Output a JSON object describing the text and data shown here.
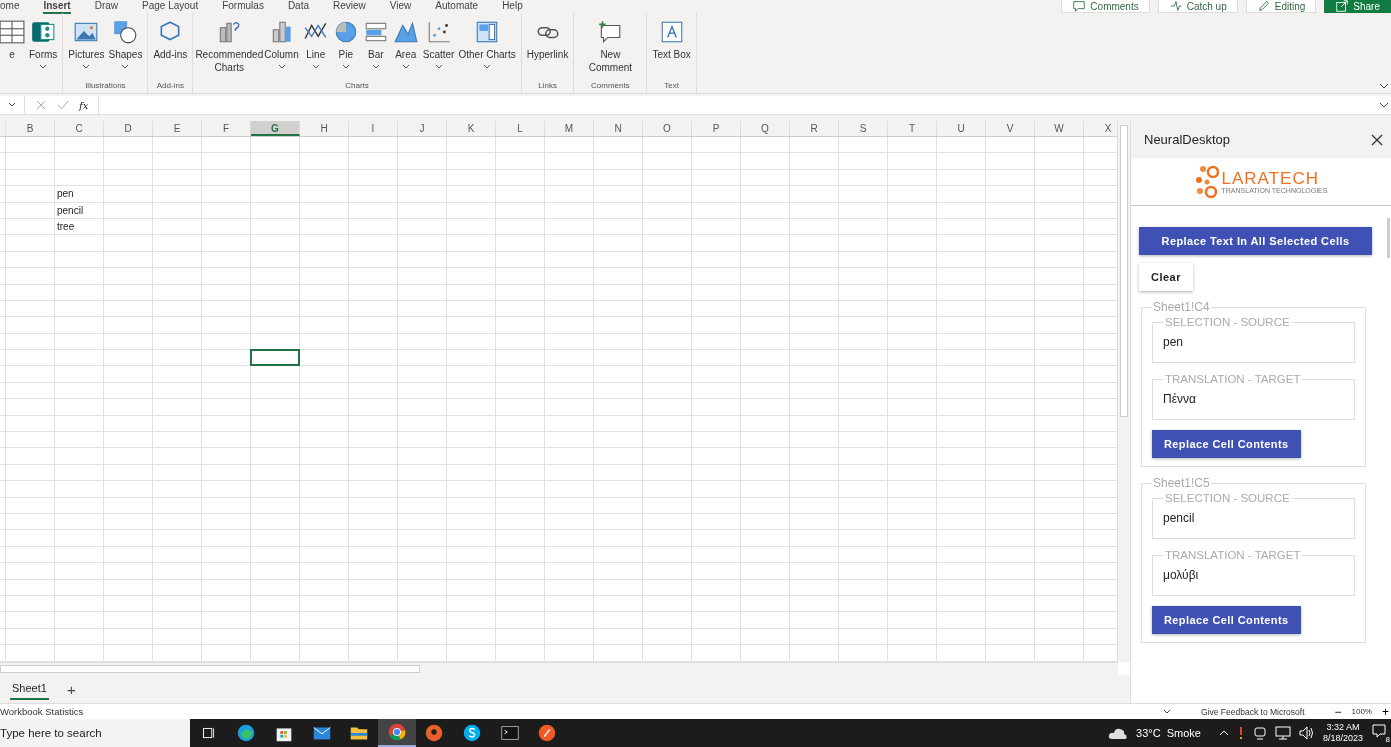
{
  "ribbon_tabs": [
    {
      "label": "ome",
      "selected": false
    },
    {
      "label": "Insert",
      "selected": true
    },
    {
      "label": "Draw",
      "selected": false
    },
    {
      "label": "Page Layout",
      "selected": false
    },
    {
      "label": "Formulas",
      "selected": false
    },
    {
      "label": "Data",
      "selected": false
    },
    {
      "label": "Review",
      "selected": false
    },
    {
      "label": "View",
      "selected": false
    },
    {
      "label": "Automate",
      "selected": false
    },
    {
      "label": "Help",
      "selected": false
    }
  ],
  "top_buttons": [
    {
      "label": "Comments",
      "kind": "comments"
    },
    {
      "label": "Catch up",
      "kind": "catchup"
    },
    {
      "label": "Editing",
      "kind": "editing"
    },
    {
      "label": "Share",
      "kind": "share"
    }
  ],
  "ribbon_groups": [
    {
      "buttons": [
        {
          "label": "e",
          "kind": "table",
          "dropdown": false
        },
        {
          "label": "Forms",
          "kind": "forms",
          "dropdown": true
        }
      ]
    },
    {
      "label": "Illustrations",
      "buttons": [
        {
          "label": "Pictures",
          "kind": "pictures",
          "dropdown": true
        },
        {
          "label": "Shapes",
          "kind": "shapes",
          "dropdown": true
        }
      ]
    },
    {
      "label": "Add-ins",
      "buttons": [
        {
          "label": "Add-ins",
          "kind": "addins",
          "dropdown": false
        }
      ]
    },
    {
      "label": "Charts",
      "buttons": [
        {
          "label": "Recommended Charts",
          "kind": "recommended",
          "dropdown": false
        },
        {
          "label": "Column",
          "kind": "column",
          "dropdown": true
        },
        {
          "label": "Line",
          "kind": "line",
          "dropdown": true
        },
        {
          "label": "Pie",
          "kind": "pie",
          "dropdown": true
        },
        {
          "label": "Bar",
          "kind": "bar",
          "dropdown": true
        },
        {
          "label": "Area",
          "kind": "area",
          "dropdown": true
        },
        {
          "label": "Scatter",
          "kind": "scatter",
          "dropdown": true
        },
        {
          "label": "Other Charts",
          "kind": "other",
          "dropdown": true
        }
      ]
    },
    {
      "label": "Links",
      "buttons": [
        {
          "label": "Hyperlink",
          "kind": "hyperlink",
          "dropdown": false
        }
      ]
    },
    {
      "label": "Comments",
      "buttons": [
        {
          "label": "New Comment",
          "kind": "comment",
          "dropdown": false
        }
      ]
    },
    {
      "label": "Text",
      "buttons": [
        {
          "label": "Text Box",
          "kind": "textbox",
          "dropdown": false
        }
      ]
    }
  ],
  "formula_bar": {
    "fx": "fx"
  },
  "grid": {
    "columns": [
      {
        "label": "B",
        "selected": false
      },
      {
        "label": "C",
        "selected": false
      },
      {
        "label": "D",
        "selected": false
      },
      {
        "label": "E",
        "selected": false
      },
      {
        "label": "F",
        "selected": false
      },
      {
        "label": "G",
        "selected": true
      },
      {
        "label": "H",
        "selected": false
      },
      {
        "label": "I",
        "selected": false
      },
      {
        "label": "J",
        "selected": false
      },
      {
        "label": "K",
        "selected": false
      },
      {
        "label": "L",
        "selected": false
      },
      {
        "label": "M",
        "selected": false
      },
      {
        "label": "N",
        "selected": false
      },
      {
        "label": "O",
        "selected": false
      },
      {
        "label": "P",
        "selected": false
      },
      {
        "label": "Q",
        "selected": false
      },
      {
        "label": "R",
        "selected": false
      },
      {
        "label": "S",
        "selected": false
      },
      {
        "label": "T",
        "selected": false
      },
      {
        "label": "U",
        "selected": false
      },
      {
        "label": "V",
        "selected": false
      },
      {
        "label": "W",
        "selected": false
      },
      {
        "label": "X",
        "selected": false
      }
    ],
    "rows": [
      {
        "selected": false
      },
      {
        "selected": false
      },
      {
        "selected": false
      },
      {
        "selected": false,
        "cells": {
          "C": "pen"
        }
      },
      {
        "selected": false,
        "cells": {
          "C": "pencil"
        }
      },
      {
        "selected": false,
        "cells": {
          "C": "tree"
        }
      },
      {
        "selected": false
      },
      {
        "selected": false
      },
      {
        "selected": false
      },
      {
        "selected": false
      },
      {
        "selected": false
      },
      {
        "selected": false
      },
      {
        "selected": false
      },
      {
        "selected": true
      },
      {
        "selected": false
      },
      {
        "selected": false
      },
      {
        "selected": false
      },
      {
        "selected": false
      },
      {
        "selected": false
      },
      {
        "selected": false
      },
      {
        "selected": false
      },
      {
        "selected": false
      },
      {
        "selected": false
      },
      {
        "selected": false
      },
      {
        "selected": false
      },
      {
        "selected": false
      },
      {
        "selected": false
      },
      {
        "selected": false
      },
      {
        "selected": false
      },
      {
        "selected": false
      },
      {
        "selected": false
      },
      {
        "selected": false
      }
    ]
  },
  "sheet_tabs": [
    {
      "label": "Sheet1",
      "selected": true
    }
  ],
  "add_sheet": "+",
  "status_bar": {
    "left": "Workbook Statistics",
    "feedback": "Give Feedback to Microsoft",
    "zoom_out": "−",
    "zoom": "100%",
    "zoom_in": "+"
  },
  "panel": {
    "title": "NeuralDesktop",
    "logo_name": "LARATECH",
    "logo_tagline": "TRANSLATION TECHNOLOGIES",
    "replace_all": "Replace Text In All Selected Cells",
    "clear": "Clear",
    "entries": [
      {
        "reference": "Sheet1!C4",
        "source_label": "SELECTION - SOURCE",
        "source": "pen",
        "target_label": "TRANSLATION - TARGET",
        "target": "Πέννα",
        "button": "Replace Cell Contents"
      },
      {
        "reference": "Sheet1!C5",
        "source_label": "SELECTION - SOURCE",
        "source": "pencil",
        "target_label": "TRANSLATION - TARGET",
        "target": "μολύβι",
        "button": "Replace Cell Contents"
      }
    ]
  },
  "taskbar": {
    "search_placeholder": "Type here to search",
    "apps": [
      {
        "kind": "taskview",
        "selected": false
      },
      {
        "kind": "edge",
        "selected": false
      },
      {
        "kind": "store",
        "selected": false
      },
      {
        "kind": "mail",
        "selected": false
      },
      {
        "kind": "folder",
        "selected": false
      },
      {
        "kind": "chrome",
        "selected": true
      },
      {
        "kind": "recorder",
        "selected": false
      },
      {
        "kind": "skype",
        "selected": false
      },
      {
        "kind": "terminal",
        "selected": false
      },
      {
        "kind": "postman",
        "selected": false
      }
    ],
    "weather": "33°C  Smoke",
    "time": "3:32 AM",
    "date": "8/18/2023",
    "notifications": "8"
  }
}
